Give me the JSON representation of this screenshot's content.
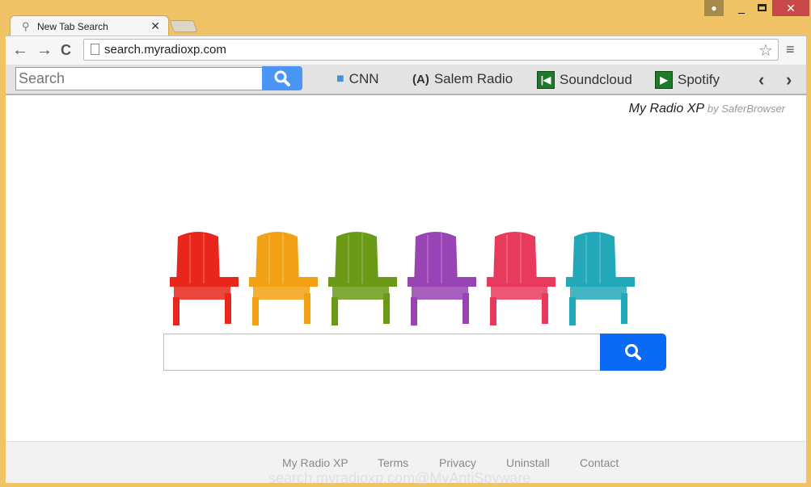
{
  "window": {
    "user_icon": "user-icon",
    "minimize": "_",
    "close": "✕"
  },
  "tab": {
    "title": "New Tab Search",
    "close": "✕"
  },
  "toolbar": {
    "url": "search.myradioxp.com",
    "back": "←",
    "forward": "→",
    "reload": "C",
    "star": "☆",
    "menu": "≡"
  },
  "extension": {
    "search_placeholder": "Search",
    "bookmarks": [
      {
        "label": "CNN",
        "icon": "chat-bubbles-icon"
      },
      {
        "label": "Salem Radio",
        "icon": "radio-tower-icon"
      },
      {
        "label": "Soundcloud",
        "icon": "skip-back-icon"
      },
      {
        "label": "Spotify",
        "icon": "play-icon"
      }
    ],
    "prev": "‹",
    "next": "›"
  },
  "page": {
    "brand": "My Radio XP",
    "brand_by": "by SaferBrowser",
    "chair_colors": [
      "#e8261b",
      "#f3a114",
      "#6a9a16",
      "#9944b4",
      "#e83a5c",
      "#22a8b8"
    ],
    "search_button_color": "#0b6af5",
    "footer": [
      "My Radio XP",
      "Terms",
      "Privacy",
      "Uninstall",
      "Contact"
    ]
  },
  "watermark": "search.myradioxp.com@MyAntiSpyware"
}
